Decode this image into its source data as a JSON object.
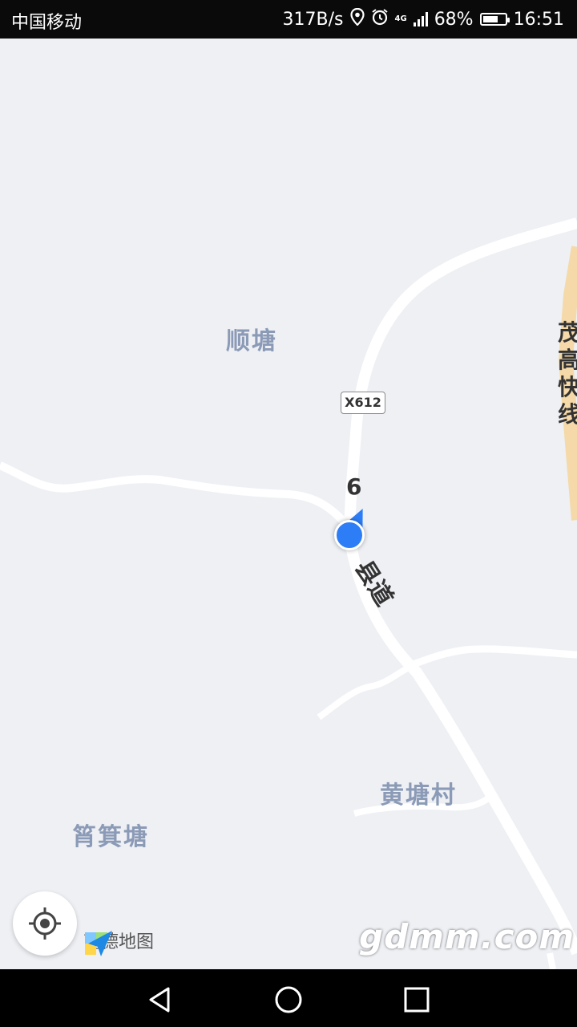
{
  "status_bar": {
    "carrier": "中国移动",
    "network_speed": "317B/s",
    "network_type": "4G",
    "battery": "68%",
    "battery_level": 0.68,
    "time": "16:51"
  },
  "map": {
    "place_labels": [
      "顺塘",
      "黄塘村",
      "筲箕塘"
    ],
    "road_badge": "X612",
    "road_number": "6",
    "road_name": "县道",
    "expressway_name": "茂高快线"
  },
  "controls": {
    "locate_icon": "crosshair-icon",
    "brand_name": "高德地图"
  },
  "watermark": "gdmm.com",
  "nav_bar": {
    "back_icon": "triangle-back-icon",
    "home_icon": "circle-home-icon",
    "recents_icon": "square-recents-icon"
  },
  "colors": {
    "map_background": "#eef0f4",
    "road": "#ffffff",
    "expressway": "#f5d9a8",
    "label": "#8b9ab6",
    "location": "#2d7df6"
  }
}
